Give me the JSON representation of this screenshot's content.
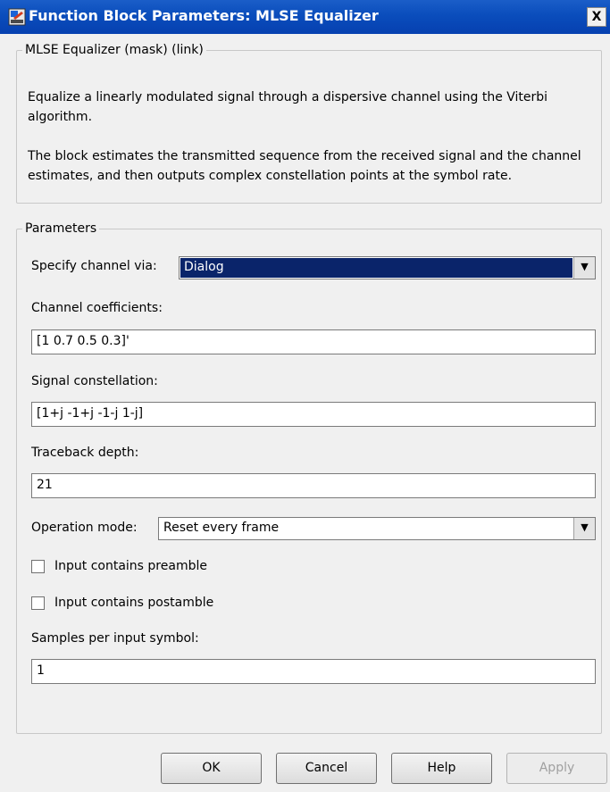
{
  "window": {
    "title": "Function Block Parameters: MLSE Equalizer",
    "close_label": "X"
  },
  "description": {
    "legend": "MLSE Equalizer (mask) (link)",
    "paragraph1": "Equalize a linearly modulated signal through a dispersive channel using the Viterbi algorithm.",
    "paragraph2": "The block estimates the transmitted sequence from the received signal and the channel estimates, and then outputs complex constellation points at the symbol rate."
  },
  "parameters": {
    "legend": "Parameters",
    "specify_channel": {
      "label": "Specify channel via:",
      "value": "Dialog"
    },
    "channel_coefficients": {
      "label": "Channel coefficients:",
      "value": "[1 0.7 0.5 0.3]'"
    },
    "signal_constellation": {
      "label": "Signal constellation:",
      "value": "[1+j -1+j -1-j 1-j]"
    },
    "traceback_depth": {
      "label": "Traceback depth:",
      "value": "21"
    },
    "operation_mode": {
      "label": "Operation mode:",
      "value": "Reset every frame"
    },
    "input_preamble": {
      "label": "Input contains preamble",
      "checked": false
    },
    "input_postamble": {
      "label": "Input contains postamble",
      "checked": false
    },
    "samples_per_symbol": {
      "label": "Samples per input symbol:",
      "value": "1"
    }
  },
  "buttons": {
    "ok": "OK",
    "cancel": "Cancel",
    "help": "Help",
    "apply": "Apply"
  },
  "icons": {
    "title_icon": "simulink-block-icon",
    "dropdown_arrow": "chevron-down-icon"
  },
  "colors": {
    "titlebar": "#0a4dbc",
    "selection": "#0a246a",
    "dialog_bg": "#f0f0f0"
  }
}
